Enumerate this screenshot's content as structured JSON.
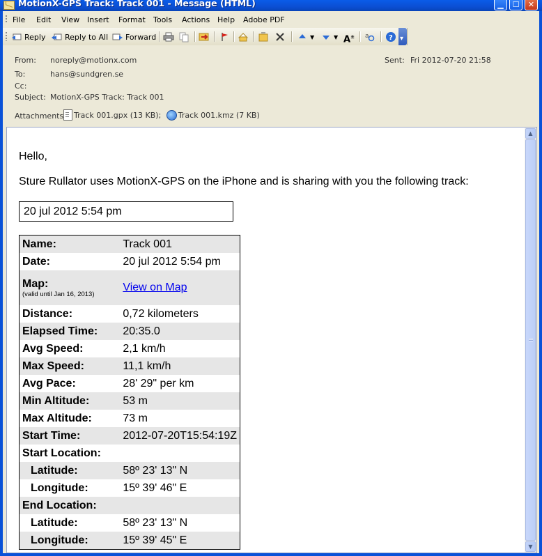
{
  "window": {
    "title": "MotionX-GPS Track: Track 001 - Message (HTML)"
  },
  "menu": [
    "File",
    "Edit",
    "View",
    "Insert",
    "Format",
    "Tools",
    "Actions",
    "Help",
    "Adobe PDF"
  ],
  "toolbar": {
    "reply": "Reply",
    "reply_all": "Reply to All",
    "forward": "Forward"
  },
  "header": {
    "from_label": "From:",
    "from": "noreply@motionx.com",
    "sent_label": "Sent:",
    "sent": "Fri 2012-07-20 21:58",
    "to_label": "To:",
    "to": "hans@sundgren.se",
    "cc_label": "Cc:",
    "cc": "",
    "subject_label": "Subject:",
    "subject": "MotionX-GPS Track: Track 001",
    "attachments_label": "Attachments:",
    "attachments": [
      "Track 001.gpx (13 KB);",
      "Track 001.kmz (7 KB)"
    ]
  },
  "message": {
    "greeting": "Hello,",
    "intro": "Sture Rullator uses MotionX-GPS on the iPhone and is sharing with you the following track:",
    "date_box": "20 jul 2012 5:54 pm",
    "rows": [
      {
        "k": "Name:",
        "v": "Track 001"
      },
      {
        "k": "Date:",
        "v": "20 jul 2012 5:54 pm"
      },
      {
        "k": "Map:",
        "note": "(valid until Jan 16, 2013)",
        "v": "View on Map"
      },
      {
        "k": "Distance:",
        "v": "0,72 kilometers"
      },
      {
        "k": "Elapsed Time:",
        "v": "20:35.0"
      },
      {
        "k": "Avg Speed:",
        "v": "2,1 km/h"
      },
      {
        "k": "Max Speed:",
        "v": "11,1 km/h"
      },
      {
        "k": "Avg Pace:",
        "v": "28' 29\" per km"
      },
      {
        "k": "Min Altitude:",
        "v": "53 m"
      },
      {
        "k": "Max Altitude:",
        "v": "73 m"
      },
      {
        "k": "Start Time:",
        "v": "2012-07-20T15:54:19Z"
      },
      {
        "k": "Start Location:",
        "v": ""
      },
      {
        "k": "Latitude:",
        "v": "58º 23' 13\" N"
      },
      {
        "k": "Longitude:",
        "v": "15º 39' 46\" E"
      },
      {
        "k": "End Location:",
        "v": ""
      },
      {
        "k": "Latitude:",
        "v": "58º 23' 13\" N"
      },
      {
        "k": "Longitude:",
        "v": "15º 39' 45\" E"
      }
    ]
  }
}
